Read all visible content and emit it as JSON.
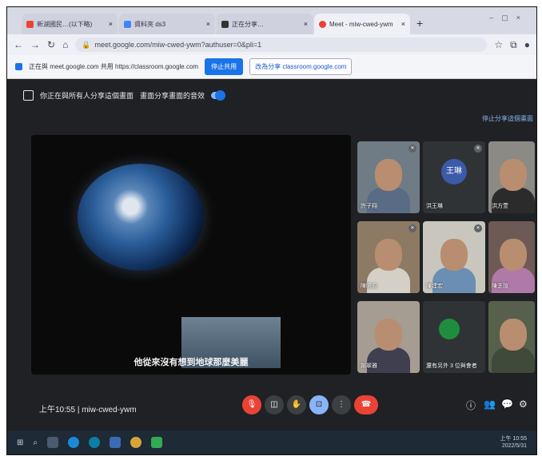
{
  "browser": {
    "tabs": [
      {
        "label": "新湖國民…ⅹ",
        "title": "新湖國民…(以下略)",
        "color": "#ea4335"
      },
      {
        "label": "資料夾 ds3",
        "title": "資料夾 ds3",
        "color": "#4285f4"
      },
      {
        "label": "正在分享…",
        "title": "正在分享…",
        "color": "#333333"
      },
      {
        "label": "Meet - miw-cwed-ywm",
        "title": "Meet - miw-cwed-ywm",
        "color": "#ea4335"
      }
    ],
    "url": "meet.google.com/miw-cwed-ywm?authuser=0&pli=1"
  },
  "share_bar": {
    "text": "正在與 meet.google.com 共用 https://classroom.google.com",
    "stop_label": "停止共用",
    "switch_label": "改為分享 classroom.google.com"
  },
  "meet": {
    "notice": "你正在與所有人分享這個畫面",
    "audio_label": "畫面分享畫面的音效",
    "stop_link": "停止分享這個畫面",
    "caption": "他從來沒有想到地球那麼美麗",
    "participants": [
      {
        "name": "許子翔",
        "kind": "video",
        "shirt": "#5a6b86"
      },
      {
        "name": "洪王琳",
        "kind": "avatar",
        "initial": "王琳"
      },
      {
        "name": "洪方萱",
        "kind": "video",
        "shirt": "#2b2b2b"
      },
      {
        "name": "陳曉盈",
        "kind": "video",
        "shirt": "#d4cfc7"
      },
      {
        "name": "陳建宏",
        "kind": "video",
        "shirt": "#6b8fb3"
      },
      {
        "name": "陳芝瑄",
        "kind": "video",
        "shirt": "#b07aa8"
      },
      {
        "name": "謝翠雅",
        "kind": "video",
        "shirt": "#3f3f50"
      },
      {
        "name": "還有另外 3 位與會者",
        "kind": "more"
      },
      {
        "name": "",
        "kind": "video",
        "shirt": "#404a3a"
      }
    ],
    "time": "上午10:55",
    "meeting_code": "miw-cwed-ywm"
  },
  "taskbar": {
    "time": "上午 10:55",
    "date": "2022/5/31"
  }
}
